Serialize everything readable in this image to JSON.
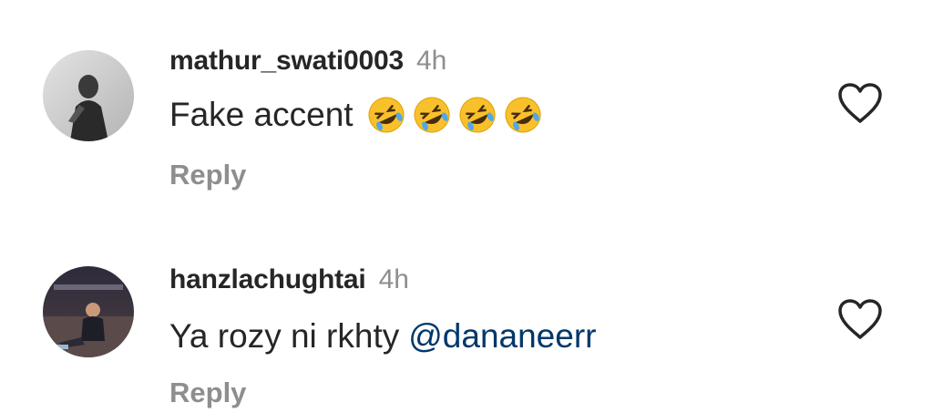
{
  "comments": [
    {
      "username": "mathur_swati0003",
      "time": "4h",
      "text": "Fake accent",
      "emojis": [
        "rolling-on-floor-laughing",
        "rolling-on-floor-laughing",
        "rolling-on-floor-laughing",
        "rolling-on-floor-laughing"
      ],
      "reply_label": "Reply",
      "like_icon": "heart-outline-icon"
    },
    {
      "username": "hanzlachughtai",
      "time": "4h",
      "text": "Ya rozy ni rkhty",
      "mention": "@dananeerr",
      "reply_label": "Reply",
      "like_icon": "heart-outline-icon"
    }
  ],
  "colors": {
    "username": "#262626",
    "meta_gray": "#8e8e8e",
    "mention": "#00376b"
  }
}
